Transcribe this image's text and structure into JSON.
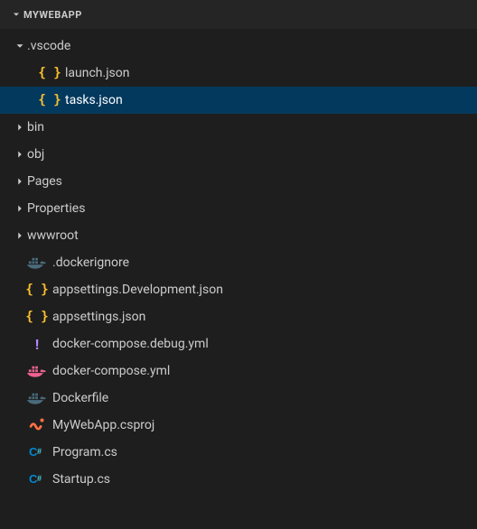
{
  "header": {
    "title": "MYWEBAPP"
  },
  "tree": {
    "root": {
      "label": "MYWEBAPP",
      "expanded": true
    },
    "vscode": {
      "label": ".vscode",
      "expanded": true
    },
    "launch": {
      "label": "launch.json"
    },
    "tasks": {
      "label": "tasks.json"
    },
    "bin": {
      "label": "bin"
    },
    "obj": {
      "label": "obj"
    },
    "pages": {
      "label": "Pages"
    },
    "properties": {
      "label": "Properties"
    },
    "wwwroot": {
      "label": "wwwroot"
    },
    "dockerignore": {
      "label": ".dockerignore"
    },
    "appsettings_dev": {
      "label": "appsettings.Development.json"
    },
    "appsettings": {
      "label": "appsettings.json"
    },
    "compose_debug": {
      "label": "docker-compose.debug.yml"
    },
    "compose": {
      "label": "docker-compose.yml"
    },
    "dockerfile": {
      "label": "Dockerfile"
    },
    "csproj": {
      "label": "MyWebApp.csproj"
    },
    "program": {
      "label": "Program.cs"
    },
    "startup": {
      "label": "Startup.cs"
    }
  },
  "colors": {
    "braces": "#fbc02d",
    "docker_faded": "#4a6b7c",
    "docker_pink": "#f06292",
    "csproj_xml": "#ff7043",
    "cs_blue": "#0288d1"
  }
}
